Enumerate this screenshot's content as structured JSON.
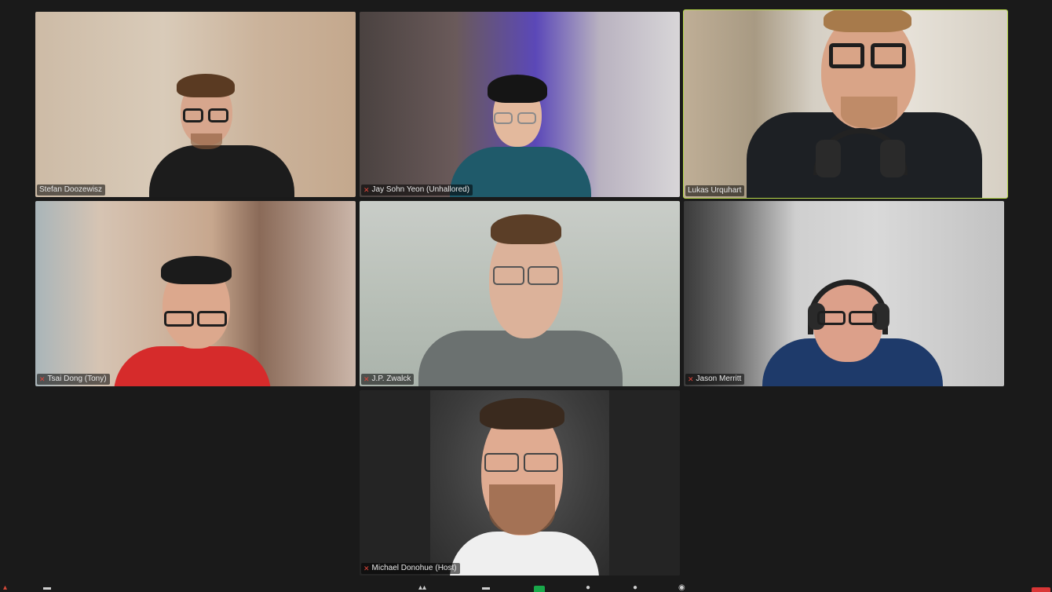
{
  "participants": [
    {
      "name": "Stefan Doozewisz",
      "active": false,
      "muted": false
    },
    {
      "name": "Jay Sohn Yeon (Unhallored)",
      "active": false,
      "muted": true
    },
    {
      "name": "Lukas Urquhart",
      "active": true,
      "muted": false
    },
    {
      "name": "Tsai Dong (Tony)",
      "active": false,
      "muted": true
    },
    {
      "name": "J.P. Zwalck",
      "active": false,
      "muted": true
    },
    {
      "name": "Jason Merritt",
      "active": false,
      "muted": true
    },
    {
      "name": "Michael Donohue",
      "active": false,
      "muted": true,
      "badge": "(Host)"
    }
  ],
  "icons": {
    "mute": "mic-muted-icon"
  },
  "colors": {
    "active_speaker": "#b7d94a",
    "muted": "#e0453a",
    "background": "#1a1a1a"
  }
}
